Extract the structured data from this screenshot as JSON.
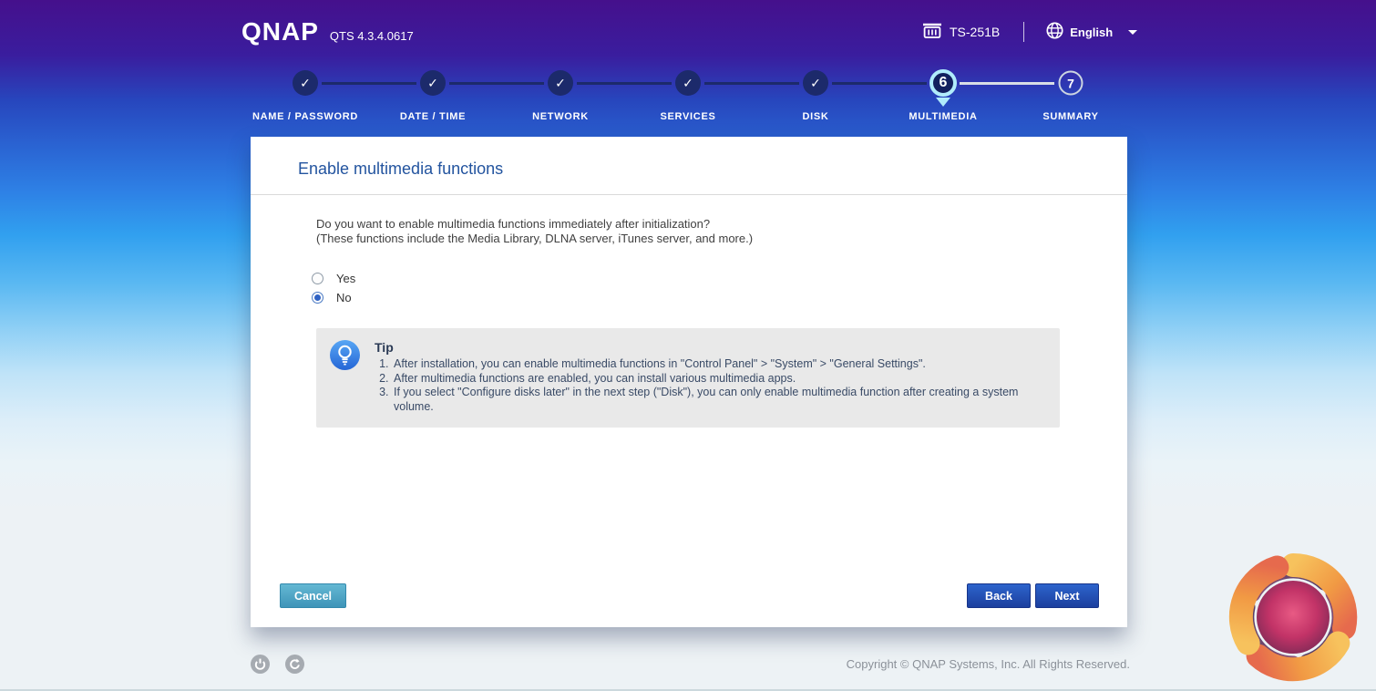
{
  "header": {
    "brand": "QNAP",
    "version": "QTS 4.3.4.0617",
    "device_model": "TS-251B",
    "language": "English"
  },
  "wizard": {
    "check_glyph": "✓",
    "steps": [
      {
        "label": "NAME / PASSWORD",
        "status": "completed"
      },
      {
        "label": "DATE / TIME",
        "status": "completed"
      },
      {
        "label": "NETWORK",
        "status": "completed"
      },
      {
        "label": "SERVICES",
        "status": "completed"
      },
      {
        "label": "DISK",
        "status": "completed"
      },
      {
        "label": "MULTIMEDIA",
        "status": "active",
        "number": "6"
      },
      {
        "label": "SUMMARY",
        "status": "upcoming",
        "number": "7"
      }
    ]
  },
  "main": {
    "title": "Enable multimedia functions",
    "question_line1": "Do you want to enable multimedia functions immediately after initialization?",
    "question_line2": "(These functions include the Media Library, DLNA server, iTunes server, and more.)",
    "options": [
      {
        "label": "Yes",
        "selected": false
      },
      {
        "label": "No",
        "selected": true
      }
    ],
    "tip": {
      "title": "Tip",
      "items": [
        "After installation, you can enable multimedia functions in \"Control Panel\" > \"System\" > \"General Settings\".",
        "After multimedia functions are enabled, you can install various multimedia apps.",
        "If you select \"Configure disks later\" in the next step (\"Disk\"), you can only enable multimedia function after creating a system volume."
      ]
    },
    "buttons": {
      "cancel": "Cancel",
      "back": "Back",
      "next": "Next"
    }
  },
  "footer": {
    "copyright": "Copyright © QNAP Systems, Inc. All Rights Reserved."
  },
  "icons": {
    "nas_device": "nas-device-icon",
    "globe": "globe-icon",
    "language_caret": "chevron-down-icon",
    "tip_bulb": "lightbulb-icon",
    "power": "power-icon",
    "restart": "restart-icon",
    "watermark": "swirl-logo"
  },
  "colors": {
    "accent_blue": "#23549f",
    "step_dark": "#1c2a6b",
    "step_active_ring": "#b0ebfb",
    "button_primary": "#1c3f9e",
    "button_cancel": "#3e94b8",
    "tip_background": "#e9e9e9"
  }
}
